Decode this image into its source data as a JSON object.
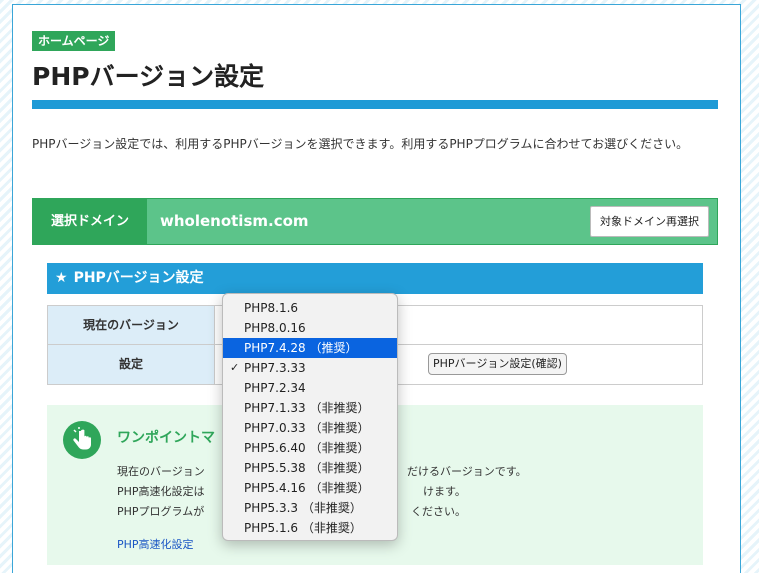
{
  "header": {
    "badge": "ホームページ",
    "title": "PHPバージョン設定"
  },
  "intro": "PHPバージョン設定では、利用するPHPバージョンを選択できます。利用するPHPプログラムに合わせてお選びください。",
  "domain": {
    "label": "選択ドメイン",
    "name": "wholenotism.com",
    "reselect_label": "対象ドメイン再選択"
  },
  "section": {
    "star": "★",
    "title": "PHPバージョン設定"
  },
  "table": {
    "current_label": "現在のバージョン",
    "setting_label": "設定",
    "confirm_label": "PHPバージョン設定(確認)"
  },
  "onepoint": {
    "title": "ワンポイントマ",
    "line1": "現在のバージョン",
    "line1_tail": "だけるバージョンです。",
    "line2": "PHP高速化設定は",
    "line2_tail": "けます。",
    "line3": "PHPプログラムが",
    "line3_tail": "ください。",
    "link": "PHP高速化設定"
  },
  "dropdown": {
    "options": [
      "PHP8.1.6",
      "PHP8.0.16",
      "PHP7.4.28 （推奨）",
      "PHP7.3.33",
      "PHP7.2.34",
      "PHP7.1.33 （非推奨）",
      "PHP7.0.33 （非推奨）",
      "PHP5.6.40 （非推奨）",
      "PHP5.5.38 （非推奨）",
      "PHP5.4.16 （非推奨）",
      "PHP5.3.3 （非推奨）",
      "PHP5.1.6 （非推奨）"
    ],
    "highlighted_option": "PHP7.4.28 （推奨）",
    "checked_option": "PHP7.3.33",
    "check_mark": "✓"
  },
  "colors": {
    "accent_blue": "#1e9ad6",
    "brand_green": "#2fa65a",
    "highlight": "#0a64e0"
  }
}
